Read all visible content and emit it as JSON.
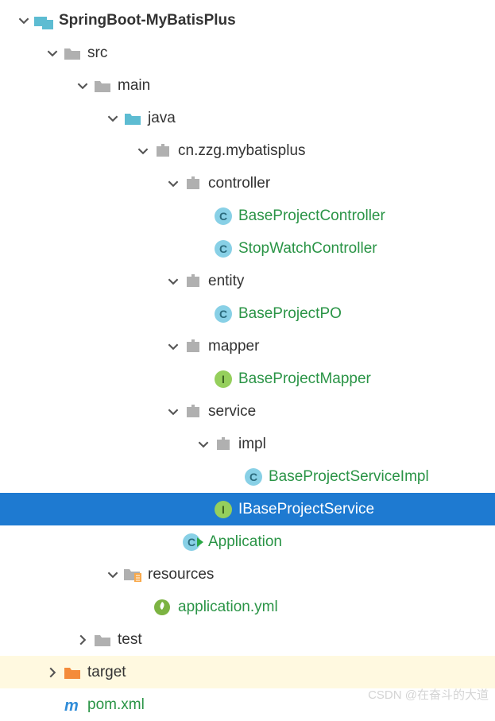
{
  "tree": {
    "root": {
      "label": "SpringBoot-MyBatisPlus",
      "src": "src",
      "main": "main",
      "java": "java",
      "package": "cn.zzg.mybatisplus",
      "controller": "controller",
      "controller_items": [
        "BaseProjectController",
        "StopWatchController"
      ],
      "entity": "entity",
      "entity_items": [
        "BaseProjectPO"
      ],
      "mapper": "mapper",
      "mapper_items": [
        "BaseProjectMapper"
      ],
      "service": "service",
      "impl": "impl",
      "impl_items": [
        "BaseProjectServiceImpl"
      ],
      "service_items": [
        "IBaseProjectService"
      ],
      "application": "Application",
      "resources": "resources",
      "resources_items": [
        "application.yml"
      ],
      "test": "test",
      "target": "target",
      "pom": "pom.xml"
    }
  },
  "watermark": "CSDN @在奋斗的大道"
}
